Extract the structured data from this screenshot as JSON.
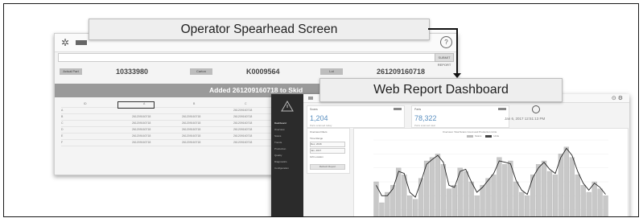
{
  "labels": {
    "operator_screen": "Operator Spearhead Screen",
    "web_dashboard": "Web Report Dashboard"
  },
  "operator": {
    "fields": [
      {
        "tag": "Actual Part",
        "value": "10333980"
      },
      {
        "tag": "Carton",
        "value": "K0009564"
      },
      {
        "tag": "Lot",
        "value": "261209160718"
      }
    ],
    "banner": "Added 261209160718 to Skid",
    "submit_label": "SUBMIT REPORT",
    "columns": [
      "ID",
      "A",
      "B",
      "C",
      "D"
    ],
    "rows": [
      [
        "A",
        "",
        "",
        "261209160718",
        "261209160718"
      ],
      [
        "B",
        "261209160718",
        "261209160718",
        "261209160718",
        "261209160718"
      ],
      [
        "C",
        "261209160718",
        "261209160718",
        "261209160718",
        "261209160718"
      ],
      [
        "D",
        "261209160718",
        "261209160718",
        "261209160718",
        "261209160718"
      ],
      [
        "E",
        "261209160718",
        "261209160718",
        "261209160718",
        "261209160718"
      ],
      [
        "F",
        "261209160718",
        "261209160718",
        "261209160718",
        "261209160718"
      ]
    ]
  },
  "web": {
    "nav": [
      "Dashboard",
      "Overview",
      "Scans",
      "Trends",
      "Production",
      "Quality",
      "Diagnostics",
      "Configuration"
    ],
    "cards": [
      {
        "title": "Scans",
        "value": "1,204",
        "sub": "Parts scanned today"
      },
      {
        "title": "Parts",
        "value": "78,322",
        "sub": "Parts scanned total"
      }
    ],
    "date": "Jan 6, 2017 12:51:13 PM",
    "panel": {
      "title": "Overview Filters",
      "time_range": "Time Range",
      "from": "Dec, 2016",
      "to": "Jan, 2017",
      "group": "Gift Location",
      "button": "Refresh Report"
    },
    "chart": {
      "title": "Overview: Total Scans Count and Production Units",
      "legend": [
        "Scans",
        "Units"
      ]
    }
  },
  "chart_data": {
    "type": "bar",
    "values": [
      60,
      30,
      45,
      55,
      80,
      70,
      40,
      35,
      65,
      90,
      95,
      100,
      85,
      50,
      55,
      80,
      75,
      60,
      40,
      55,
      65,
      70,
      95,
      85,
      90,
      60,
      45,
      40,
      70,
      85,
      90,
      75,
      70,
      100,
      110,
      95,
      70,
      55,
      45,
      60,
      50,
      40
    ],
    "line": [
      55,
      40,
      40,
      50,
      75,
      72,
      45,
      38,
      60,
      85,
      92,
      98,
      88,
      55,
      52,
      75,
      78,
      60,
      45,
      52,
      62,
      72,
      90,
      88,
      86,
      62,
      48,
      42,
      66,
      80,
      88,
      78,
      72,
      95,
      108,
      98,
      75,
      58,
      48,
      58,
      52,
      42
    ],
    "ylim": [
      0,
      120
    ]
  }
}
